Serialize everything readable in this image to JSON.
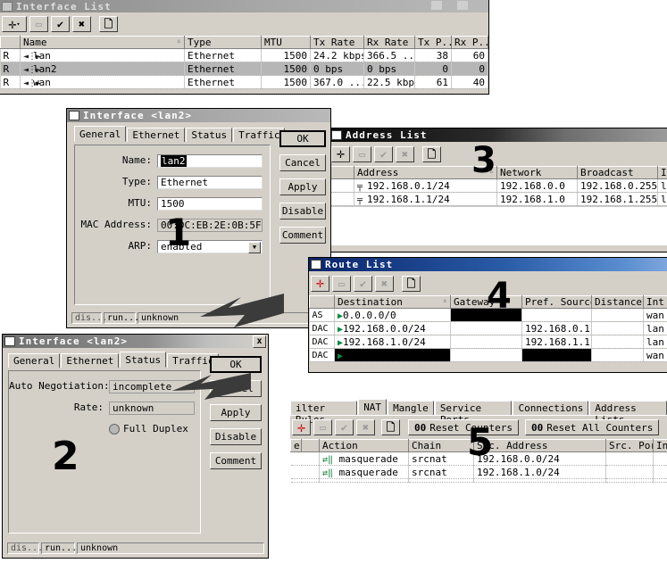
{
  "interface_list": {
    "title": "Interface List",
    "toolbar": [
      "add-icon",
      "remove-icon",
      "enable-icon",
      "disable-icon",
      "comment-icon"
    ],
    "columns": [
      "",
      "Name",
      "Type",
      "MTU",
      "Tx Rate",
      "Rx Rate",
      "Tx P...",
      "Rx P..."
    ],
    "rows": [
      {
        "flag": "R",
        "name": "lan",
        "type": "Ethernet",
        "mtu": "1500",
        "tx": "24.2 kbps",
        "rx": "366.5 ...",
        "txp": "38",
        "rxp": "60",
        "selected": false
      },
      {
        "flag": "R",
        "name": "lan2",
        "type": "Ethernet",
        "mtu": "1500",
        "tx": "0 bps",
        "rx": "0 bps",
        "txp": "0",
        "rxp": "0",
        "selected": true
      },
      {
        "flag": "R",
        "name": "wan",
        "type": "Ethernet",
        "mtu": "1500",
        "tx": "367.0 ...",
        "rx": "22.5 kbps",
        "txp": "61",
        "rxp": "40",
        "selected": false
      }
    ]
  },
  "iface_general": {
    "title": "Interface <lan2>",
    "tabs": [
      "General",
      "Ethernet",
      "Status",
      "Traffic"
    ],
    "active_tab": "General",
    "fields": [
      {
        "label": "Name:",
        "value": "lan2"
      },
      {
        "label": "Type:",
        "value": "Ethernet"
      },
      {
        "label": "MTU:",
        "value": "1500"
      },
      {
        "label": "MAC Address:",
        "value": "00:0C:EB:2E:0B:5F"
      },
      {
        "label": "ARP:",
        "value": "enabled"
      }
    ],
    "buttons": [
      "OK",
      "Cancel",
      "Apply",
      "Disable",
      "Comment"
    ],
    "status": [
      "dis...",
      "run...",
      "unknown"
    ],
    "annotation": "1"
  },
  "iface_status": {
    "title": "Interface <lan2>",
    "tabs": [
      "General",
      "Ethernet",
      "Status",
      "Traffic"
    ],
    "active_tab": "Status",
    "fields": [
      {
        "label": "Auto Negotiation:",
        "value": "incomplete"
      },
      {
        "label": "Rate:",
        "value": "unknown"
      }
    ],
    "checkbox": "Full Duplex",
    "buttons": [
      "OK",
      "Cancel",
      "Apply",
      "Disable",
      "Comment"
    ],
    "status": [
      "dis...",
      "run...",
      "unknown"
    ],
    "close_label": "x",
    "annotation": "2"
  },
  "address_list": {
    "title": "Address List",
    "columns": [
      "",
      "Address",
      "Network",
      "Broadcast",
      "In"
    ],
    "rows": [
      {
        "address": "192.168.0.1/24",
        "network": "192.168.0.0",
        "broadcast": "192.168.0.255",
        "iface": "l."
      },
      {
        "address": "192.168.1.1/24",
        "network": "192.168.1.0",
        "broadcast": "192.168.1.255",
        "iface": "l."
      }
    ],
    "annotation": "3"
  },
  "route_list": {
    "title": "Route List",
    "columns": [
      "",
      "Destination",
      "Gateway",
      "Pref. Source",
      "Distance",
      "Int"
    ],
    "rows": [
      {
        "flags": "AS",
        "destination": "0.0.0.0/0",
        "gateway": "",
        "gateway_redacted": true,
        "pref_source": "",
        "pref_redacted": false,
        "distance": "",
        "iface": "wan",
        "row_redacted": false
      },
      {
        "flags": "DAC",
        "destination": "192.168.0.0/24",
        "gateway": "",
        "gateway_redacted": false,
        "pref_source": "192.168.0.1",
        "pref_redacted": false,
        "distance": "",
        "iface": "lan",
        "row_redacted": false
      },
      {
        "flags": "DAC",
        "destination": "192.168.1.0/24",
        "gateway": "",
        "gateway_redacted": false,
        "pref_source": "192.168.1.1",
        "pref_redacted": false,
        "distance": "",
        "iface": "lan",
        "row_redacted": false
      },
      {
        "flags": "DAC",
        "destination": "",
        "gateway": "",
        "gateway_redacted": false,
        "pref_source": "",
        "pref_redacted": true,
        "distance": "",
        "iface": "wan",
        "row_redacted": true
      }
    ],
    "annotation": "4"
  },
  "firewall": {
    "tabs": [
      "ilter Rules",
      "NAT",
      "Mangle",
      "Service Ports",
      "Connections",
      "Address Lists"
    ],
    "active_tab": "NAT",
    "reset_counters": "Reset Counters",
    "reset_all_counters": "Reset All Counters",
    "counter_prefix": "00",
    "columns": [
      "e",
      "",
      "Action",
      "Chain",
      "Src. Address",
      "Src. Port",
      "In."
    ],
    "rows": [
      {
        "action": "masquerade",
        "chain": "srcnat",
        "src_address": "192.168.0.0/24",
        "src_port": "",
        "in": ""
      },
      {
        "action": "masquerade",
        "chain": "srcnat",
        "src_address": "192.168.1.0/24",
        "src_port": "",
        "in": ""
      }
    ],
    "annotation": "5"
  },
  "colors": {
    "face": "#d4d0c8",
    "active_title": "#0a246a",
    "accent_green": "#00a000",
    "accent_red": "#cc0000"
  }
}
